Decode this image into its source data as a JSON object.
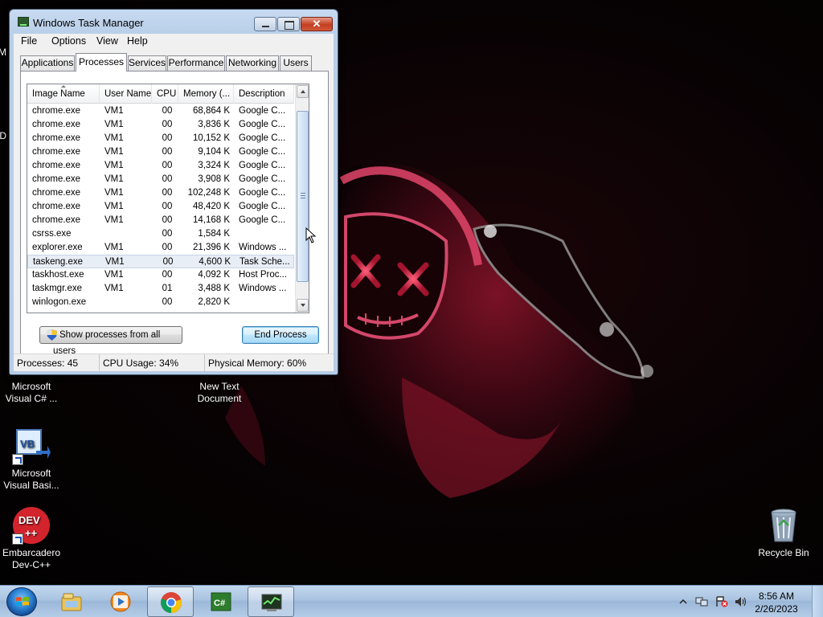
{
  "window": {
    "title": "Windows Task Manager",
    "close_glyph": "✕"
  },
  "menu": {
    "items": [
      "File",
      "Options",
      "View",
      "Help"
    ]
  },
  "tabs": [
    {
      "label": "Applications",
      "active": false
    },
    {
      "label": "Processes",
      "active": true
    },
    {
      "label": "Services",
      "active": false
    },
    {
      "label": "Performance",
      "active": false
    },
    {
      "label": "Networking",
      "active": false
    },
    {
      "label": "Users",
      "active": false
    }
  ],
  "process_table": {
    "columns": [
      "Image Name",
      "User Name",
      "CPU",
      "Memory (...",
      "Description"
    ],
    "sort_column": "Image Name",
    "selected_row": 11,
    "rows": [
      {
        "name": "chrome.exe",
        "user": "VM1",
        "cpu": "00",
        "memory": "68,864 K",
        "description": "Google C..."
      },
      {
        "name": "chrome.exe",
        "user": "VM1",
        "cpu": "00",
        "memory": "3,836 K",
        "description": "Google C..."
      },
      {
        "name": "chrome.exe",
        "user": "VM1",
        "cpu": "00",
        "memory": "10,152 K",
        "description": "Google C..."
      },
      {
        "name": "chrome.exe",
        "user": "VM1",
        "cpu": "00",
        "memory": "9,104 K",
        "description": "Google C..."
      },
      {
        "name": "chrome.exe",
        "user": "VM1",
        "cpu": "00",
        "memory": "3,324 K",
        "description": "Google C..."
      },
      {
        "name": "chrome.exe",
        "user": "VM1",
        "cpu": "00",
        "memory": "3,908 K",
        "description": "Google C..."
      },
      {
        "name": "chrome.exe",
        "user": "VM1",
        "cpu": "00",
        "memory": "102,248 K",
        "description": "Google C..."
      },
      {
        "name": "chrome.exe",
        "user": "VM1",
        "cpu": "00",
        "memory": "48,420 K",
        "description": "Google C..."
      },
      {
        "name": "chrome.exe",
        "user": "VM1",
        "cpu": "00",
        "memory": "14,168 K",
        "description": "Google C..."
      },
      {
        "name": "csrss.exe",
        "user": "",
        "cpu": "00",
        "memory": "1,584 K",
        "description": ""
      },
      {
        "name": "explorer.exe",
        "user": "VM1",
        "cpu": "00",
        "memory": "21,396 K",
        "description": "Windows ..."
      },
      {
        "name": "taskeng.exe",
        "user": "VM1",
        "cpu": "00",
        "memory": "4,600 K",
        "description": "Task Sche..."
      },
      {
        "name": "taskhost.exe",
        "user": "VM1",
        "cpu": "00",
        "memory": "4,092 K",
        "description": "Host Proc..."
      },
      {
        "name": "taskmgr.exe",
        "user": "VM1",
        "cpu": "01",
        "memory": "3,488 K",
        "description": "Windows ..."
      },
      {
        "name": "winlogon.exe",
        "user": "",
        "cpu": "00",
        "memory": "2,820 K",
        "description": ""
      }
    ]
  },
  "buttons": {
    "show_all": "Show processes from all users",
    "end_process": "End Process"
  },
  "status": {
    "processes": "Processes: 45",
    "cpu": "CPU Usage: 34%",
    "memory": "Physical Memory: 60%"
  },
  "desktop_icons": [
    {
      "label": "Microsoft Visual C# ...",
      "icon": "csharp-icon"
    },
    {
      "label": "New Text Document",
      "icon": "text-document-icon"
    },
    {
      "label": "Microsoft Visual Basi...",
      "icon": "visual-basic-icon"
    },
    {
      "label": "Embarcadero Dev-C++",
      "icon": "dev-cpp-icon"
    },
    {
      "label": "Recycle Bin",
      "icon": "recycle-bin-icon"
    }
  ],
  "desktop_icon_glyphs": {
    "vb": "VB",
    "dev": "DEV",
    "dev_plus": "++"
  },
  "taskbar": {
    "apps": [
      "explorer-icon",
      "media-player-icon",
      "chrome-icon",
      "visual-csharp-icon",
      "task-manager-icon"
    ],
    "csharp_glyph": "C#",
    "clock_time": "8:56 AM",
    "clock_date": "2/26/2023"
  },
  "edge_glyphs": {
    "m": "M",
    "d": "D"
  }
}
